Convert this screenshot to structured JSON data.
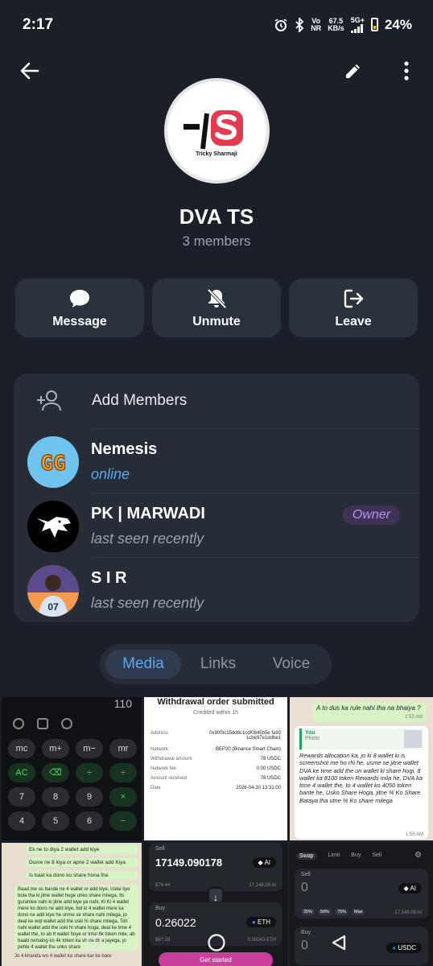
{
  "status_bar": {
    "time": "2:17",
    "net_top": "Vo",
    "net_bottom": "NR",
    "speed_top": "67.5",
    "speed_bottom": "KB/s",
    "signal_label": "5G+",
    "battery": "24%"
  },
  "header": {
    "back_icon": "arrow-left-icon",
    "edit_icon": "pencil-icon",
    "more_icon": "vertical-dots-icon"
  },
  "profile": {
    "logo_letters": "-|S",
    "logo_caption": "Tricky Sharmaji",
    "name": "DVA TS",
    "members": "3 members"
  },
  "actions": [
    {
      "label": "Message",
      "icon": "chat-bubble-icon"
    },
    {
      "label": "Unmute",
      "icon": "bell-off-icon"
    },
    {
      "label": "Leave",
      "icon": "leave-icon"
    }
  ],
  "members_card": {
    "add_label": "Add Members",
    "members": [
      {
        "name": "Nemesis",
        "status": "online",
        "badge": "",
        "avatar_text": "GG"
      },
      {
        "name": "PK | MARWADI",
        "status": "last seen recently",
        "badge": "Owner",
        "avatar_text": ""
      },
      {
        "name": "S I R",
        "status": "last seen recently",
        "badge": "",
        "avatar_text": "07"
      }
    ]
  },
  "tabs": [
    {
      "label": "Media",
      "active": true
    },
    {
      "label": "Links",
      "active": false
    },
    {
      "label": "Voice",
      "active": false
    }
  ],
  "media": {
    "calc": {
      "top_number": "110",
      "keys": [
        "mc",
        "m+",
        "m−",
        "mr",
        "AC",
        "⌫",
        "÷",
        "÷",
        "7",
        "8",
        "9",
        "×",
        "4",
        "5",
        "6",
        "−"
      ]
    },
    "withdrawal": {
      "title": "Withdrawal order submitted",
      "subtitle": "Credited within 1h",
      "rows": [
        {
          "k": "Address",
          "v": "0x90f3c15dd8c1cdf0845b5e fa93 1cbe97e1ddbe1"
        },
        {
          "k": "Network",
          "v": "BEP20 (Binance Smart Chain)"
        },
        {
          "k": "Withdrawal amount",
          "v": "78 USDC"
        },
        {
          "k": "Network fee",
          "v": "0.00 USDC"
        },
        {
          "k": "Amount received",
          "v": "78 USDC"
        },
        {
          "k": "Date",
          "v": "2026-04-30 13:31:00"
        }
      ]
    },
    "chat": {
      "top": "A to dus ka rule nahi tha na bhaiya ?",
      "time": "1:53 AM",
      "quote_name": "You",
      "quote_text": "Photo",
      "body": "Rewards allocation ka, jo ki 8 wallet ki is screenshot me ho rhi he, usme se jitne wallet DVA ke time add the un wallet ki share hogi, 8 wallet ka 8100 token Rewards mila he, DVA ka time 4 wallet the, to 4 wallet ko 4050 token bante he, Usko Share Hoga, jitne % Ko Share Bataya tha utne % Ko share milega",
      "time2": "1:55 AM"
    },
    "note": {
      "line1": "Ek ne to diya 2 wallet add kiye",
      "line2": "Dusre ne 8 kiya or apne 2 wallet add Kiya",
      "line3": "Is baat ka dono ko share hona tha",
      "body": "Baad me us bande ne 4 wallet or add kiye, Uske liye bola tha ki jitne wallet hoge unko share milega, Its gurantee nahi ki jitne add kiye ya nahi, Ki Ki 4 wallet mere ko dono ne add kiye, bol ki 4 wallet mere ka dono ne add kiye he unme se share nahi milega, jo deal ke wqt wallet add the uski hi share milega, Toh nahi wallet add the uski hi share hoga, deal ke time 4 wallet the, to ab 8 wallet hoye or total 8k token mile, ab baaki remaing ko 4k token ka share diya jayega, jo pehle 4 wallet the unko share",
      "footer": "Jo 4 khanda wo 4 wallet ka share kar ke bare"
    },
    "swap1": {
      "sell_label": "Sell",
      "sell_amount": "17149.090178",
      "sell_token": "AI",
      "sell_usd": "$74.44",
      "sell_balance": "17,149.09 AI",
      "buy_label": "Buy",
      "buy_amount": "0.26022",
      "buy_token": "ETH",
      "buy_usd": "$67.59",
      "buy_balance": "0.00043 ETH",
      "button": "Get started"
    },
    "swap2": {
      "tabs": [
        "Swap",
        "Limit",
        "Buy",
        "Sell"
      ],
      "sell_label": "Sell",
      "sell_amount": "0",
      "sell_token": "AI",
      "pcts": [
        "25%",
        "50%",
        "75%",
        "Max"
      ],
      "balance": "17,149.09 AI",
      "buy_label": "Buy",
      "buy_amount": "0",
      "buy_token": "USDC"
    }
  },
  "nav": {
    "recents_icon": "recents-square-icon",
    "home_icon": "home-circle-icon",
    "back_icon": "back-triangle-icon"
  },
  "colors": {
    "background": "#1b2028",
    "card": "#262d36",
    "accent": "#59a7ee",
    "owner": "#b990f6",
    "logo_red": "#e53950"
  }
}
